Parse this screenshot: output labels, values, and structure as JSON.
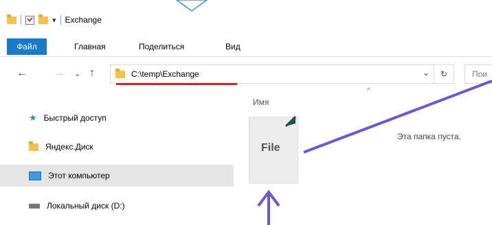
{
  "window": {
    "title": "Exchange"
  },
  "ribbon": {
    "tabs": [
      "Файл",
      "Главная",
      "Поделиться",
      "Вид"
    ]
  },
  "address": {
    "path": "C:\\temp\\Exchange",
    "search_placeholder": "Пои"
  },
  "sidebar": {
    "items": [
      "Быстрый доступ",
      "Яндекс.Диск",
      "Этот компьютер",
      "Локальный диск (D:)"
    ]
  },
  "content": {
    "column_header": "Имя",
    "empty_message": "Эта папка пуста.",
    "dragged_item_label": "File"
  },
  "colors": {
    "accent": "#1979ca",
    "underline": "#e02020",
    "annotation_arrow": "#6a5ad0"
  }
}
